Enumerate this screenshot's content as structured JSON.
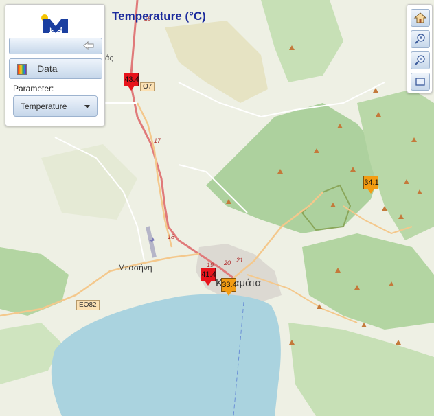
{
  "title": "Temperature (°C)",
  "logo": {
    "text": "Meteo",
    "icon": "meteo-m-logo"
  },
  "panel": {
    "collapse_icon": "left-arrow-icon",
    "data_button_label": "Data",
    "data_icon": "rainbow-palette-icon",
    "parameter_label": "Parameter:",
    "parameter_value": "Temperature"
  },
  "zoom_controls": [
    "home-icon",
    "zoom-in-icon",
    "zoom-out-icon",
    "zoom-extent-icon"
  ],
  "stations": [
    {
      "value": "43.4",
      "color": "#e8141c"
    },
    {
      "value": "41.4",
      "color": "#e8141c"
    },
    {
      "value": "33.4",
      "color": "#f39c12"
    },
    {
      "value": "34.1",
      "color": "#f39c12"
    }
  ],
  "labels": {
    "place_top": "άς",
    "town_west": "Μεσσήνη",
    "city": "Καλαμάτα",
    "road_eo82": "ΕΟ82",
    "road_eo7": "O7",
    "road_16": "16",
    "road_17": "17",
    "road_18": "18",
    "road_19": "19",
    "road_20": "20",
    "road_21": "21"
  },
  "colors": {
    "sea": "#aad3df",
    "forest": "#add19e",
    "land": "#f2efe9",
    "title": "#1a2a9c",
    "hot_marker": "#e8141c",
    "warm_marker": "#f39c12"
  }
}
